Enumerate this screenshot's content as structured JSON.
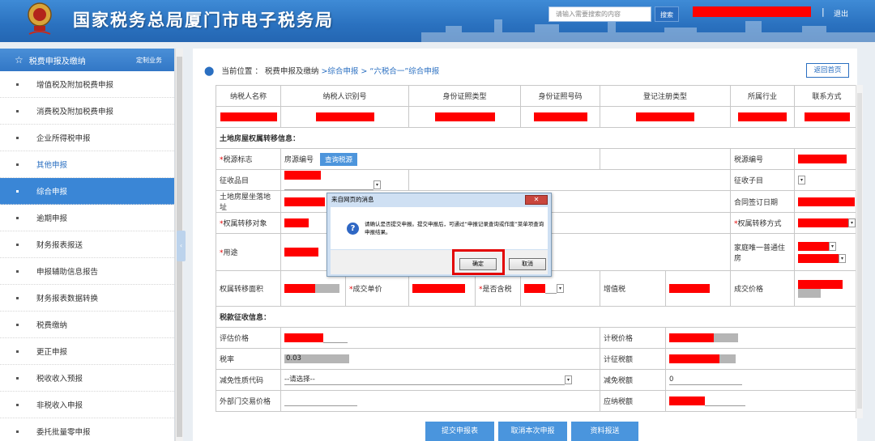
{
  "header": {
    "title": "国家税务总局厦门市电子税务局",
    "search_placeholder": "请输入需要搜索的内容",
    "search_label": "搜索",
    "separator": "|",
    "logout": "退出",
    "brand_color": "#2a71bf"
  },
  "sidebar": {
    "title": "税费申报及缴纳",
    "custom": "定制业务",
    "items": [
      {
        "label": "增值税及附加税费申报"
      },
      {
        "label": "消费税及附加税费申报"
      },
      {
        "label": "企业所得税申报"
      },
      {
        "label": "其他申报"
      },
      {
        "label": "综合申报"
      },
      {
        "label": "逾期申报"
      },
      {
        "label": "财务报表报送"
      },
      {
        "label": "申报辅助信息报告"
      },
      {
        "label": "财务报表数据转换"
      },
      {
        "label": "税费缴纳"
      },
      {
        "label": "更正申报"
      },
      {
        "label": "税收收入预报"
      },
      {
        "label": "非税收入申报"
      },
      {
        "label": "委托批量零申报"
      }
    ]
  },
  "breadcrumb": {
    "prefix": "当前位置 ：",
    "level1": "税费申报及缴纳",
    "rest": ">综合申报 > “六税合一”综合申报",
    "home_button": "返回首页"
  },
  "taxpayer_table": {
    "headers": [
      "纳税人名称",
      "纳税人识别号",
      "身份证照类型",
      "身份证照号码",
      "登记注册类型",
      "所属行业",
      "联系方式"
    ]
  },
  "property_section": {
    "title": "土地房屋权属转移信息：",
    "tax_source_flag": "税源标志",
    "house_source_no": "房源编号",
    "query_button": "查询税源",
    "tax_source_no": "税源编号",
    "collection_item": "征收品目",
    "collection_subitem": "征收子目",
    "location": "土地房屋坐落地址",
    "contract_date": "合同签订日期",
    "transfer_object": "权属转移对象",
    "transfer_method": "权属转移方式",
    "usage": "用途",
    "family_unique": "家庭唯一普通住房",
    "transfer_area": "权属转移面积",
    "unit_price": "成交单价",
    "tax_included": "是否含税",
    "vat": "增值税",
    "deal_price": "成交价格"
  },
  "levy_section": {
    "title": "税款征收信息：",
    "assessed_price": "评估价格",
    "taxable_price": "计税价格",
    "tax_rate": "税率",
    "tax_rate_value": "0.03",
    "levy_amount": "计征税额",
    "exemption_code": "减免性质代码",
    "exemption_placeholder": "--请选择--",
    "exemption_amount": "减免税额",
    "exemption_amount_value": "0",
    "external_price": "外部门交易价格",
    "payable_tax": "应纳税额"
  },
  "bottom_buttons": {
    "submit": "提交申报表",
    "cancel": "取消本次申报",
    "submit_docs": "资料报送"
  },
  "dialog": {
    "title": "来自网页的消息",
    "message": "请确认是否提交申报。提交申报后，可通过“申报记录查询或作废”菜单项查询申报结果。",
    "confirm": "确定",
    "cancel": "取消"
  }
}
